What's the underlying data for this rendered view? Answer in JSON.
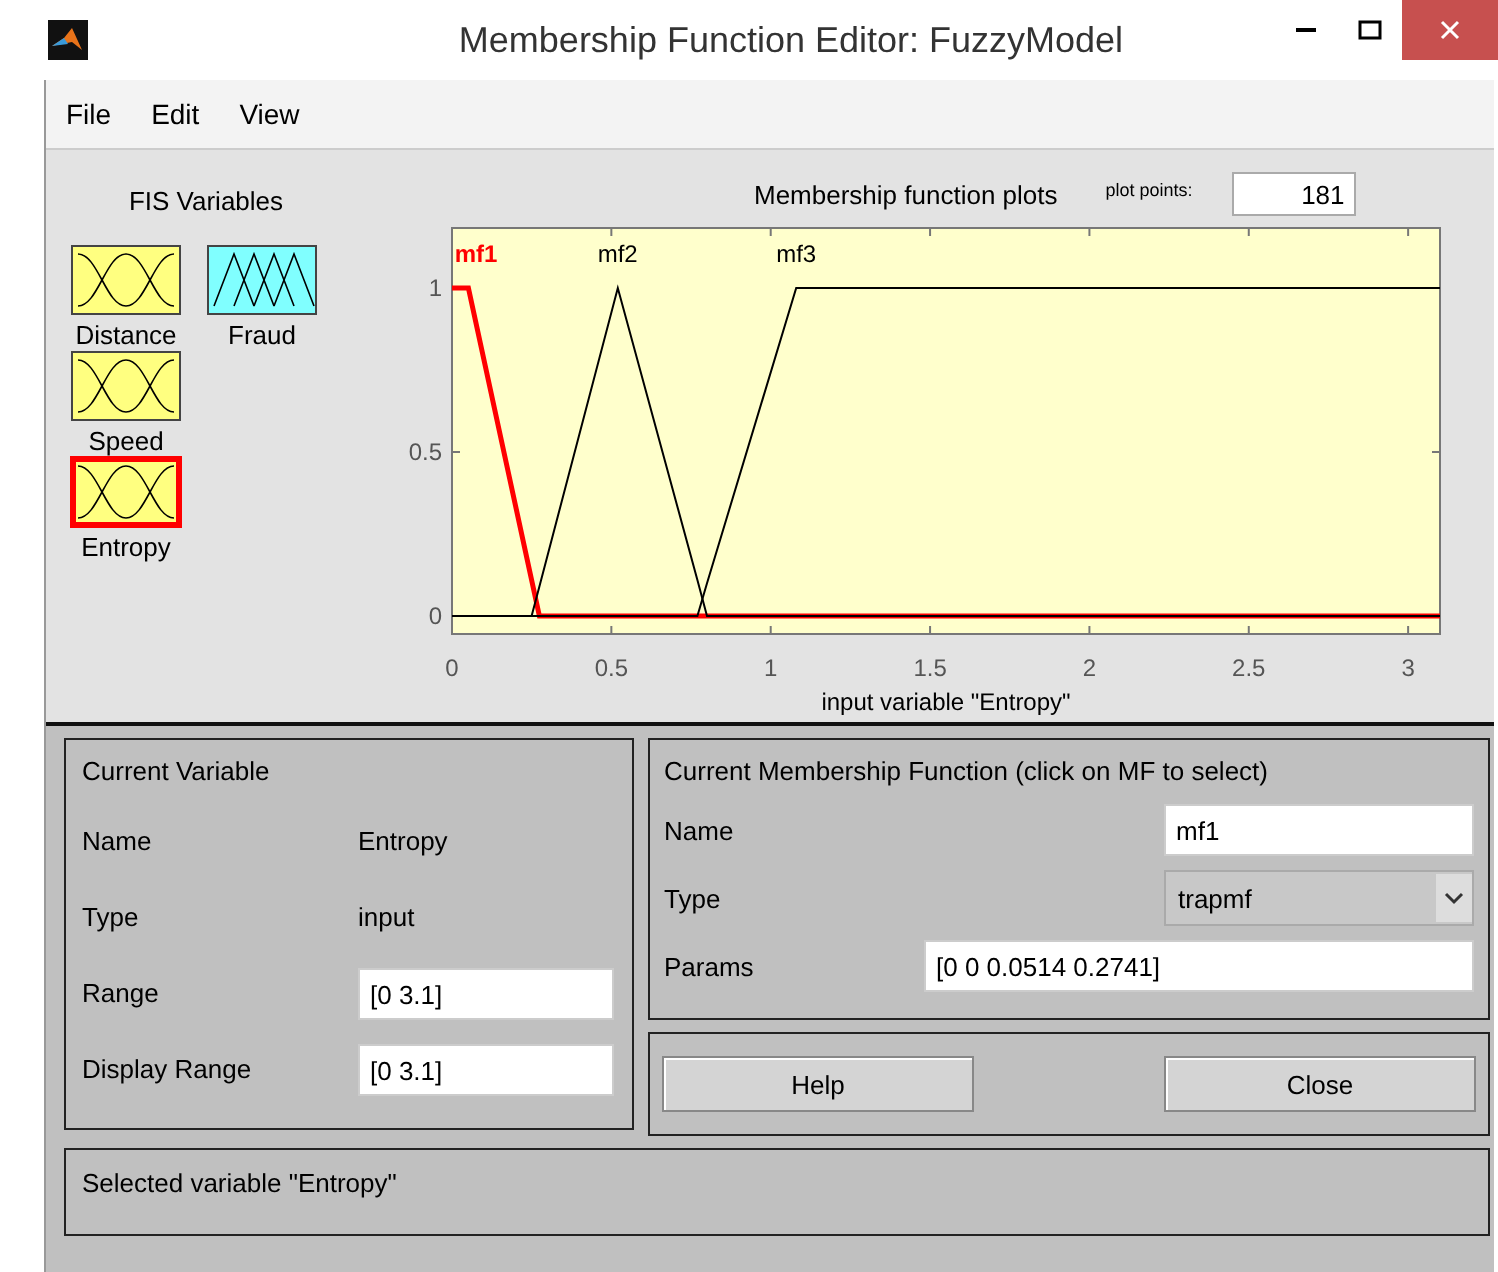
{
  "window": {
    "title": "Membership Function Editor: FuzzyModel"
  },
  "menu": [
    "File",
    "Edit",
    "View"
  ],
  "fis_variables": {
    "title": "FIS Variables",
    "items": [
      {
        "label": "Distance",
        "kind": "input",
        "selected": false
      },
      {
        "label": "Fraud",
        "kind": "output",
        "selected": false
      },
      {
        "label": "Speed",
        "kind": "input",
        "selected": false
      },
      {
        "label": "Entropy",
        "kind": "input",
        "selected": true
      }
    ]
  },
  "plot": {
    "title": "Membership function plots",
    "plot_points_label": "plot points:",
    "plot_points": "181",
    "chart_data": {
      "type": "line",
      "xlabel": "input variable \"Entropy\"",
      "x": [
        0,
        0.0514,
        0.25,
        0.2741,
        0.52,
        0.77,
        0.8,
        1.08,
        3.1
      ],
      "series": [
        {
          "name": "mf1",
          "color": "#ff0000",
          "values": [
            1,
            1,
            0.11,
            0,
            0,
            0,
            0,
            0,
            0
          ]
        },
        {
          "name": "mf2",
          "color": "#000000",
          "values": [
            0,
            0,
            0,
            0.09,
            1,
            0.11,
            0,
            0,
            0
          ]
        },
        {
          "name": "mf3",
          "color": "#000000",
          "values": [
            0,
            0,
            0,
            0,
            0,
            0,
            0.1,
            1,
            1
          ]
        }
      ],
      "xlim": [
        0,
        3.1
      ],
      "ylim": [
        0,
        1
      ],
      "xticks": [
        0,
        0.5,
        1,
        1.5,
        2,
        2.5,
        3
      ],
      "yticks": [
        0,
        0.5,
        1
      ]
    }
  },
  "current_variable": {
    "title": "Current Variable",
    "name_label": "Name",
    "name": "Entropy",
    "type_label": "Type",
    "type": "input",
    "range_label": "Range",
    "range": "[0 3.1]",
    "display_range_label": "Display Range",
    "display_range": "[0 3.1]"
  },
  "current_mf": {
    "title": "Current Membership Function (click on MF to select)",
    "name_label": "Name",
    "name": "mf1",
    "type_label": "Type",
    "type": "trapmf",
    "params_label": "Params",
    "params": "[0 0 0.0514 0.2741]"
  },
  "buttons": [
    "Help",
    "Close"
  ],
  "status": "Selected variable \"Entropy\""
}
